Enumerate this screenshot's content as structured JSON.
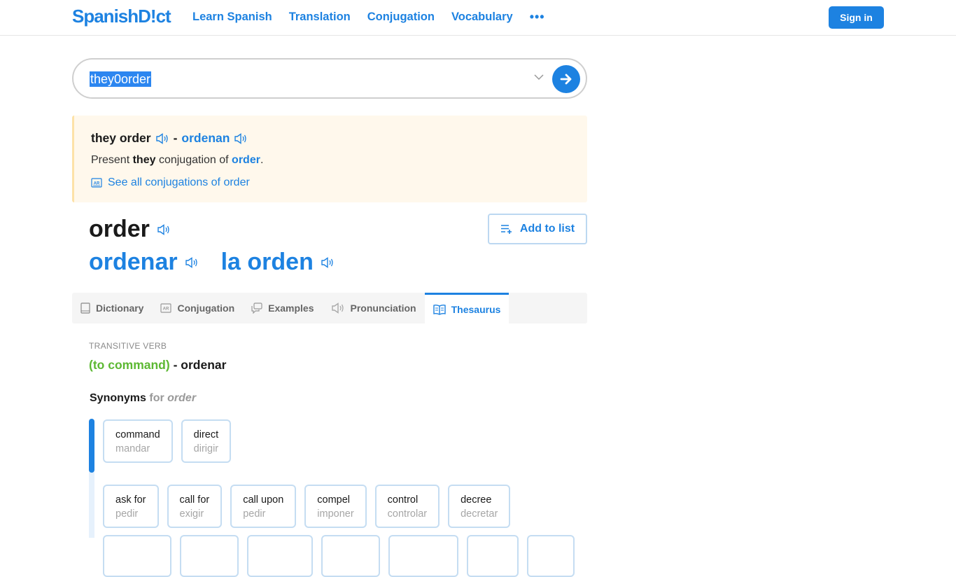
{
  "header": {
    "logo": "SpanishD!ct",
    "nav": [
      "Learn Spanish",
      "Translation",
      "Conjugation",
      "Vocabulary"
    ],
    "more": "•••",
    "sign_in": "Sign in"
  },
  "search": {
    "value": "they0order"
  },
  "conjugation_card": {
    "phrase": "they order",
    "separator": "-",
    "translation": "ordenan",
    "desc_prefix": "Present",
    "desc_pronoun": "they",
    "desc_mid": "conjugation of",
    "desc_verb": "order",
    "desc_suffix": ".",
    "see_all": "See all conjugations of order"
  },
  "entry": {
    "headword": "order",
    "translations": [
      "ordenar",
      "la orden"
    ],
    "add_to_list": "Add to list"
  },
  "tabs": [
    {
      "label": "Dictionary",
      "icon": "book-icon",
      "active": false
    },
    {
      "label": "Conjugation",
      "icon": "conjugation-icon",
      "active": false
    },
    {
      "label": "Examples",
      "icon": "speech-bubbles-icon",
      "active": false
    },
    {
      "label": "Pronunciation",
      "icon": "speaker-icon",
      "active": false
    },
    {
      "label": "Thesaurus",
      "icon": "open-book-icon",
      "active": true
    }
  ],
  "thesaurus": {
    "part_of_speech": "TRANSITIVE VERB",
    "sense": "(to command)",
    "sense_sep": "-",
    "sense_translation": "ordenar",
    "synonyms_label": "Synonyms",
    "synonyms_for": "for",
    "synonyms_word": "order",
    "group1": [
      {
        "en": "command",
        "es": "mandar"
      },
      {
        "en": "direct",
        "es": "dirigir"
      }
    ],
    "group2": [
      {
        "en": "ask for",
        "es": "pedir"
      },
      {
        "en": "call for",
        "es": "exigir"
      },
      {
        "en": "call upon",
        "es": "pedir"
      },
      {
        "en": "compel",
        "es": "imponer"
      },
      {
        "en": "control",
        "es": "controlar"
      },
      {
        "en": "decree",
        "es": "decretar"
      }
    ]
  }
}
